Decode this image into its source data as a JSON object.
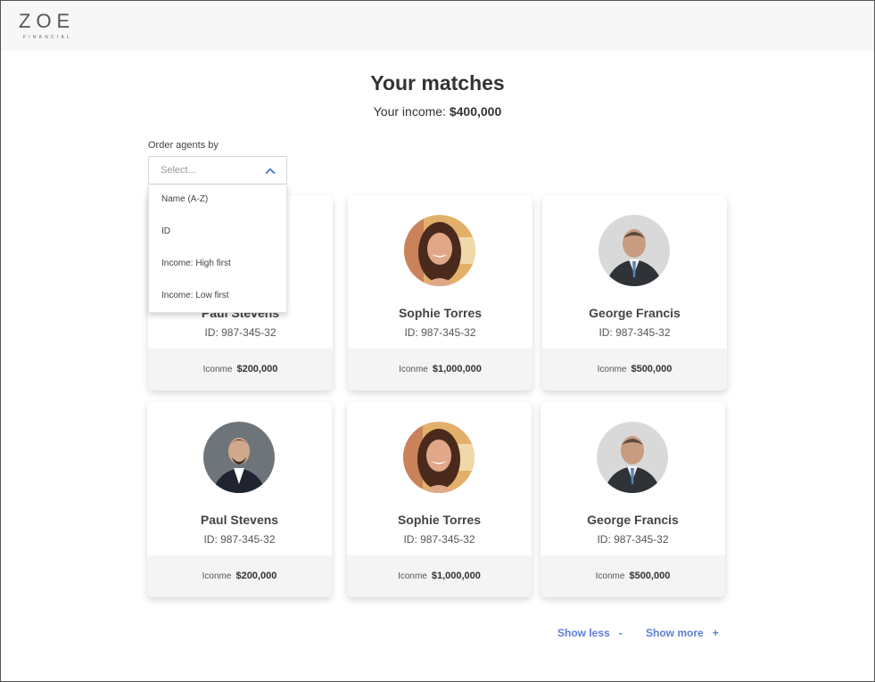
{
  "brand": {
    "name": "ZOE",
    "tagline": "FINANCIAL"
  },
  "page": {
    "title": "Your matches"
  },
  "income": {
    "label": "Your income:",
    "value": "$400,000"
  },
  "order": {
    "label": "Order agents by",
    "placeholder": "Select...",
    "options": [
      "Name (A-Z)",
      "ID",
      "Income: High first",
      "Income: Low first"
    ]
  },
  "agents": [
    {
      "name": "Paul Stevens",
      "id": "ID: 987-345-32",
      "income_label": "Iconme",
      "income": "$200,000"
    },
    {
      "name": "Sophie Torres",
      "id": "ID: 987-345-32",
      "income_label": "Iconme",
      "income": "$1,000,000"
    },
    {
      "name": "George Francis",
      "id": "ID: 987-345-32",
      "income_label": "Iconme",
      "income": "$500,000"
    },
    {
      "name": "Paul Stevens",
      "id": "ID: 987-345-32",
      "income_label": "Iconme",
      "income": "$200,000"
    },
    {
      "name": "Sophie Torres",
      "id": "ID: 987-345-32",
      "income_label": "Iconme",
      "income": "$1,000,000"
    },
    {
      "name": "George Francis",
      "id": "ID: 987-345-32",
      "income_label": "Iconme",
      "income": "$500,000"
    }
  ],
  "pagination": {
    "less_label": "Show less",
    "less_symbol": "-",
    "more_label": "Show more",
    "more_symbol": "+"
  },
  "colors": {
    "accent": "#5b7fd6",
    "header_bg": "#f7f7f7",
    "card_footer_bg": "#f4f4f4"
  }
}
